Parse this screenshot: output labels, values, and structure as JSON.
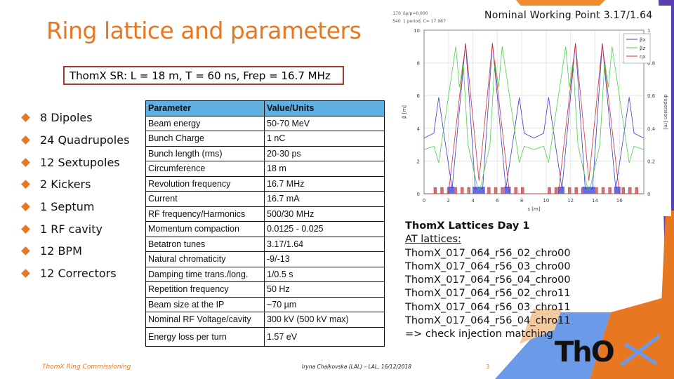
{
  "title": "Ring lattice and parameters",
  "summary_box": "ThomX SR: L = 18 m, T = 60 ns, Frep = 16.7 MHz",
  "components": [
    "8 Dipoles",
    "24 Quadrupoles",
    "12 Sextupoles",
    "2 Kickers",
    "1 Septum",
    "1 RF cavity",
    "12 BPM",
    "12 Correctors"
  ],
  "table": {
    "headers": [
      "Parameter",
      "Value/Units"
    ],
    "rows": [
      [
        "Beam energy",
        "50-70 MeV"
      ],
      [
        "Bunch Charge",
        "1 nC"
      ],
      [
        "Bunch length (rms)",
        "20-30 ps"
      ],
      [
        "Circumference",
        "18 m"
      ],
      [
        "Revolution frequency",
        "16.7 MHz"
      ],
      [
        "Current",
        "16.7 mA"
      ],
      [
        "RF frequency/Harmonics",
        "500/30 MHz"
      ],
      [
        "Momentum compaction",
        "0.0125 - 0.025"
      ],
      [
        "Betatron tunes",
        "3.17/1.64"
      ],
      [
        "Natural chromaticity",
        "-9/-13"
      ],
      [
        "Damping time trans./long.",
        "1/0.5 s"
      ],
      [
        "Repetition frequency",
        "50 Hz"
      ],
      [
        "Beam size at the IP",
        "~70 µm"
      ],
      [
        "Nominal RF Voltage/cavity",
        "300 kV (500 kV max)"
      ],
      [
        "Energy loss per turn",
        "1.57 eV"
      ]
    ]
  },
  "plot_caption": "Nominal Working Point 3.17/1.64",
  "chart_data": {
    "type": "line",
    "header_text": [
      "νx = 3.170",
      "δp/p=0.000",
      "νz = 1.540",
      "1 period, C= 17.987"
    ],
    "xlabel": "s [m]",
    "ylabel": "β [m]",
    "y2label": "dispersion [m]",
    "xlim": [
      0,
      18
    ],
    "ylim": [
      0,
      10
    ],
    "y2lim": [
      0,
      1
    ],
    "xticks": [
      0,
      2,
      4,
      6,
      8,
      10,
      12,
      14,
      16
    ],
    "yticks": [
      0,
      2,
      4,
      6,
      8,
      10
    ],
    "y2ticks": [
      0,
      0.2,
      0.4,
      0.6,
      0.8,
      1
    ],
    "grid": true,
    "legend": "top-right",
    "series": [
      {
        "name": "βx",
        "axis": "left",
        "color": "#3b3bd0",
        "points": [
          [
            0,
            3.4
          ],
          [
            0.8,
            3.7
          ],
          [
            1.2,
            5.9
          ],
          [
            1.6,
            3.8
          ],
          [
            2.3,
            0.3
          ],
          [
            3.4,
            9.2
          ],
          [
            4.2,
            0.3
          ],
          [
            4.8,
            0.3
          ],
          [
            5.6,
            9.2
          ],
          [
            6.7,
            0.3
          ],
          [
            7.4,
            3.8
          ],
          [
            7.8,
            5.9
          ],
          [
            8.2,
            3.7
          ],
          [
            9,
            3.4
          ],
          [
            9.8,
            3.7
          ],
          [
            10.2,
            5.9
          ],
          [
            10.6,
            3.8
          ],
          [
            11.3,
            0.3
          ],
          [
            12.4,
            9.2
          ],
          [
            13.2,
            0.3
          ],
          [
            13.8,
            0.3
          ],
          [
            14.6,
            9.2
          ],
          [
            15.7,
            0.3
          ],
          [
            16.4,
            3.8
          ],
          [
            16.8,
            5.9
          ],
          [
            17.2,
            3.7
          ],
          [
            18,
            3.4
          ]
        ]
      },
      {
        "name": "βz",
        "axis": "left",
        "color": "#4ccf4c",
        "points": [
          [
            0,
            2.7
          ],
          [
            0.8,
            2.9
          ],
          [
            1.2,
            1.9
          ],
          [
            2.6,
            9.0
          ],
          [
            2.9,
            6.5
          ],
          [
            3.2,
            8.1
          ],
          [
            3.6,
            3.0
          ],
          [
            4.4,
            0.3
          ],
          [
            4.6,
            0.3
          ],
          [
            5.4,
            3.0
          ],
          [
            5.8,
            8.1
          ],
          [
            6.1,
            6.5
          ],
          [
            6.4,
            9.0
          ],
          [
            7.8,
            1.9
          ],
          [
            8.2,
            2.9
          ],
          [
            9,
            2.7
          ],
          [
            9.8,
            2.9
          ],
          [
            10.2,
            1.9
          ],
          [
            11.6,
            9.0
          ],
          [
            11.9,
            6.5
          ],
          [
            12.2,
            8.1
          ],
          [
            12.6,
            3.0
          ],
          [
            13.4,
            0.3
          ],
          [
            13.6,
            0.3
          ],
          [
            14.4,
            3.0
          ],
          [
            14.8,
            8.1
          ],
          [
            15.1,
            6.5
          ],
          [
            15.4,
            9.0
          ],
          [
            16.8,
            1.9
          ],
          [
            17.2,
            2.9
          ],
          [
            18,
            2.7
          ]
        ]
      },
      {
        "name": "ηx",
        "axis": "right",
        "color": "#d03030",
        "points": [
          [
            0,
            0
          ],
          [
            2.0,
            0
          ],
          [
            3.4,
            0.92
          ],
          [
            4.5,
            0.08
          ],
          [
            5.6,
            0.92
          ],
          [
            7.0,
            0
          ],
          [
            11.0,
            0
          ],
          [
            12.4,
            0.92
          ],
          [
            13.5,
            0.08
          ],
          [
            14.6,
            0.92
          ],
          [
            16.0,
            0
          ],
          [
            18,
            0
          ]
        ]
      }
    ]
  },
  "lattices": {
    "heading": "ThomX Lattices Day 1",
    "subheading": "AT lattices:",
    "files": [
      "ThomX_017_064_r56_02_chro00",
      "ThomX_017_064_r56_03_chro00",
      "ThomX_017_064_r56_04_chro00",
      "ThomX_017_064_r56_02_chro11",
      "ThomX_017_064_r56_03_chro11",
      "ThomX_017_064_r56_04_chro11"
    ],
    "note": "=> check injection matching"
  },
  "footer": {
    "left": "ThomX Ring Commissioning",
    "center": "Iryna Chaikovska (LAL) – LAL, 16/12/2018",
    "page": "3"
  },
  "logo": "ThomX",
  "colors": {
    "accent": "#e87722",
    "table_header": "#5eaee0",
    "purple": "#5a3fb0",
    "blue": "#6b9be8"
  }
}
